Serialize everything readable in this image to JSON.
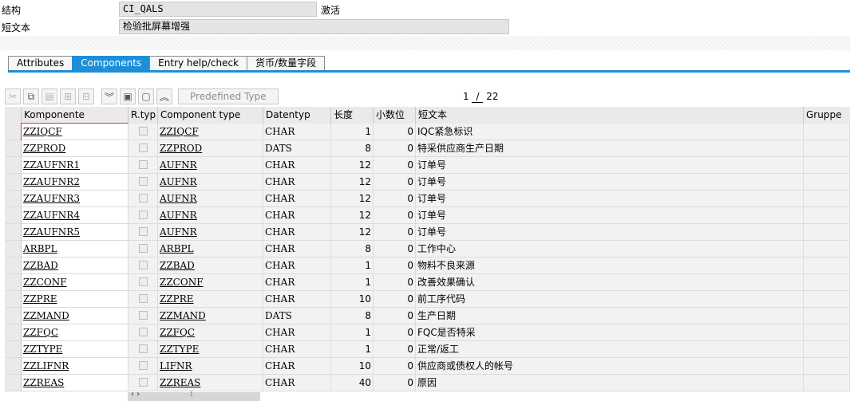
{
  "header": {
    "structure_label": "结构",
    "structure_value": "CI_QALS",
    "status": "激活",
    "short_text_label": "短文本",
    "short_text_value": "检验批屏幕增强"
  },
  "tabs": [
    {
      "label": "Attributes",
      "active": false
    },
    {
      "label": "Components",
      "active": true
    },
    {
      "label": "Entry help/check",
      "active": false
    },
    {
      "label": "货币/数量字段",
      "active": false
    }
  ],
  "toolbar": {
    "icons": [
      "cut-icon",
      "copy-icon",
      "paste-icon",
      "insert-row-icon",
      "delete-row-icon",
      "collapse-icon",
      "select-all-icon",
      "deselect-icon",
      "expand-icon"
    ],
    "predefined_type_label": "Predefined Type"
  },
  "pager": {
    "current": "1",
    "separator": "/",
    "total": "22"
  },
  "columns": [
    "Komponente",
    "R.typ",
    "Component type",
    "Datentyp",
    "长度",
    "小数位",
    "短文本",
    "Gruppe"
  ],
  "rows": [
    {
      "comp": "ZZIQCF",
      "ctype": "ZZIQCF",
      "dtype": "CHAR",
      "len": "1",
      "dec": "0",
      "text": "IQC紧急标识"
    },
    {
      "comp": "ZZPROD",
      "ctype": "ZZPROD",
      "dtype": "DATS",
      "len": "8",
      "dec": "0",
      "text": "特采供应商生产日期"
    },
    {
      "comp": "ZZAUFNR1",
      "ctype": "AUFNR",
      "dtype": "CHAR",
      "len": "12",
      "dec": "0",
      "text": "订单号"
    },
    {
      "comp": "ZZAUFNR2",
      "ctype": "AUFNR",
      "dtype": "CHAR",
      "len": "12",
      "dec": "0",
      "text": "订单号"
    },
    {
      "comp": "ZZAUFNR3",
      "ctype": "AUFNR",
      "dtype": "CHAR",
      "len": "12",
      "dec": "0",
      "text": "订单号"
    },
    {
      "comp": "ZZAUFNR4",
      "ctype": "AUFNR",
      "dtype": "CHAR",
      "len": "12",
      "dec": "0",
      "text": "订单号"
    },
    {
      "comp": "ZZAUFNR5",
      "ctype": "AUFNR",
      "dtype": "CHAR",
      "len": "12",
      "dec": "0",
      "text": "订单号"
    },
    {
      "comp": "ARBPL",
      "ctype": "ARBPL",
      "dtype": "CHAR",
      "len": "8",
      "dec": "0",
      "text": "工作中心"
    },
    {
      "comp": "ZZBAD",
      "ctype": "ZZBAD",
      "dtype": "CHAR",
      "len": "1",
      "dec": "0",
      "text": "物料不良来源"
    },
    {
      "comp": "ZZCONF",
      "ctype": "ZZCONF",
      "dtype": "CHAR",
      "len": "1",
      "dec": "0",
      "text": "改善效果确认"
    },
    {
      "comp": "ZZPRE",
      "ctype": "ZZPRE",
      "dtype": "CHAR",
      "len": "10",
      "dec": "0",
      "text": "前工序代码"
    },
    {
      "comp": "ZZMAND",
      "ctype": "ZZMAND",
      "dtype": "DATS",
      "len": "8",
      "dec": "0",
      "text": "生产日期"
    },
    {
      "comp": "ZZFQC",
      "ctype": "ZZFQC",
      "dtype": "CHAR",
      "len": "1",
      "dec": "0",
      "text": "FQC是否特采"
    },
    {
      "comp": "ZZTYPE",
      "ctype": "ZZTYPE",
      "dtype": "CHAR",
      "len": "1",
      "dec": "0",
      "text": "正常/返工"
    },
    {
      "comp": "ZZLIFNR",
      "ctype": "LIFNR",
      "dtype": "CHAR",
      "len": "10",
      "dec": "0",
      "text": "供应商或债权人的帐号"
    },
    {
      "comp": "ZZREAS",
      "ctype": "ZZREAS",
      "dtype": "CHAR",
      "len": "40",
      "dec": "0",
      "text": "原因"
    }
  ],
  "colors": {
    "tab_active": "#1e8fd6",
    "focus_border": "#e03b24",
    "field_bg": "#e4e4e4"
  }
}
